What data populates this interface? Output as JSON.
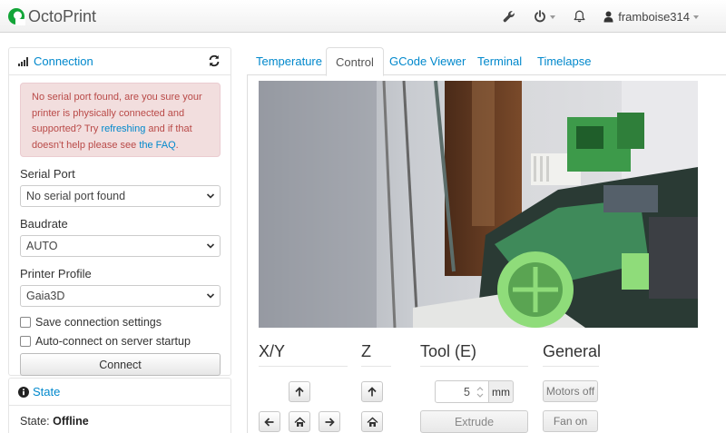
{
  "app": {
    "brand": "OctoPrint"
  },
  "navbar": {
    "icons": [
      "wrench-icon",
      "power-icon",
      "bell-icon",
      "user-icon"
    ],
    "user": "framboise314"
  },
  "connection": {
    "title": "Connection",
    "alert": {
      "text_before": "No serial port found, are you sure your printer is physically connected and supported? Try ",
      "link1": "refreshing",
      "text_middle": " and if that doesn't help please see ",
      "link2": "the FAQ",
      "text_after": "."
    },
    "serial_port": {
      "label": "Serial Port",
      "value": "No serial port found"
    },
    "baudrate": {
      "label": "Baudrate",
      "value": "AUTO"
    },
    "printer_profile": {
      "label": "Printer Profile",
      "value": "Gaia3D"
    },
    "save_settings": "Save connection settings",
    "auto_connect": "Auto-connect on server startup",
    "connect_button": "Connect"
  },
  "state": {
    "title": "State",
    "label": "State:",
    "value": "Offline"
  },
  "tabs": [
    {
      "label": "Temperature",
      "active": false
    },
    {
      "label": "Control",
      "active": true
    },
    {
      "label": "GCode Viewer",
      "active": false
    },
    {
      "label": "Terminal",
      "active": false
    },
    {
      "label": "Timelapse",
      "active": false
    }
  ],
  "control": {
    "xy_title": "X/Y",
    "z_title": "Z",
    "tool_title": "Tool (E)",
    "general_title": "General",
    "extrude_amount": "5",
    "extrude_unit": "mm",
    "extrude_button": "Extrude",
    "motors_off_button": "Motors off",
    "fan_on_button": "Fan on"
  },
  "colors": {
    "link": "#0088cc",
    "alert_bg": "#f2dede",
    "alert_text": "#b94a48",
    "logo_green": "#13a538"
  }
}
